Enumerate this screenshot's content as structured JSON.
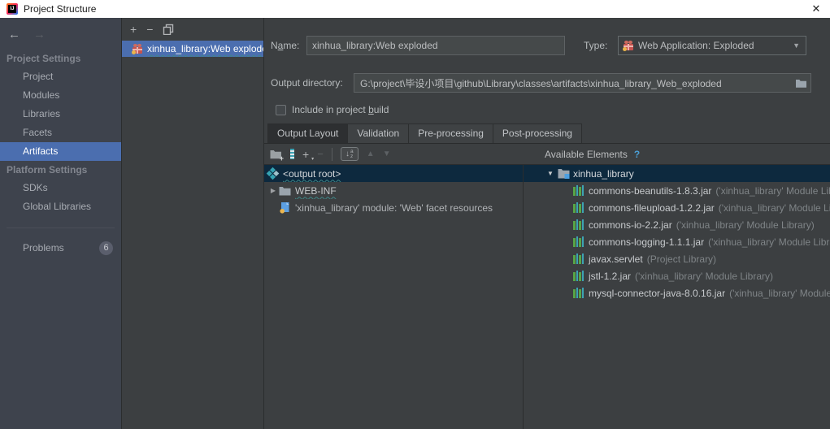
{
  "window": {
    "title": "Project Structure"
  },
  "icons": {
    "logo": "IJ",
    "close": "✕",
    "back": "←",
    "forward": "→",
    "add": "+",
    "remove": "−",
    "minus_disabled": "−",
    "sort_arrow": "↓",
    "sort_a": "a",
    "sort_z": "z",
    "move_up": "▲",
    "move_down": "▼",
    "chevron_right": "▶",
    "chevron_down": "▼",
    "combo_arrow": "▼",
    "help": "?",
    "new_folder_plus": "+",
    "add_dropdown": "▾"
  },
  "sidebar": {
    "sections": [
      {
        "header": "Project Settings",
        "items": [
          "Project",
          "Modules",
          "Libraries",
          "Facets",
          "Artifacts"
        ]
      },
      {
        "header": "Platform Settings",
        "items": [
          "SDKs",
          "Global Libraries"
        ]
      }
    ],
    "selected_item": "Artifacts",
    "problems": {
      "label": "Problems",
      "count": "6"
    }
  },
  "artifact_list": {
    "selected_item": "xinhua_library:Web exploded"
  },
  "form": {
    "name_label": {
      "pre": "N",
      "mn": "a",
      "post": "me:"
    },
    "name_value": "xinhua_library:Web exploded",
    "type_label": "Type:",
    "type_value": "Web Application: Exploded",
    "output_dir_label": "Output directory:",
    "output_dir_value": "G:\\project\\毕设小项目\\github\\Library\\classes\\artifacts\\xinhua_library_Web_exploded",
    "include_label": {
      "pre": "Include in project ",
      "mn": "b",
      "post": "uild"
    }
  },
  "tabs": [
    "Output Layout",
    "Validation",
    "Pre-processing",
    "Post-processing"
  ],
  "selected_tab": "Output Layout",
  "available_header": {
    "label": "Available Elements",
    "help": "?"
  },
  "output_tree": {
    "root": "<output root>",
    "child_folder": "WEB-INF",
    "facet_row": "'xinhua_library' module: 'Web' facet resources"
  },
  "available": {
    "root": "xinhua_library",
    "items": [
      {
        "name": "commons-beanutils-1.8.3.jar",
        "detail": "('xinhua_library' Module Library)"
      },
      {
        "name": "commons-fileupload-1.2.2.jar",
        "detail": "('xinhua_library' Module Library)"
      },
      {
        "name": "commons-io-2.2.jar",
        "detail": "('xinhua_library' Module Library)"
      },
      {
        "name": "commons-logging-1.1.1.jar",
        "detail": "('xinhua_library' Module Library)"
      },
      {
        "name": "javax.servlet",
        "detail": "(Project Library)"
      },
      {
        "name": "jstl-1.2.jar",
        "detail": "('xinhua_library' Module Library)"
      },
      {
        "name": "mysql-connector-java-8.0.16.jar",
        "detail": "('xinhua_library' Module Library)"
      }
    ]
  }
}
